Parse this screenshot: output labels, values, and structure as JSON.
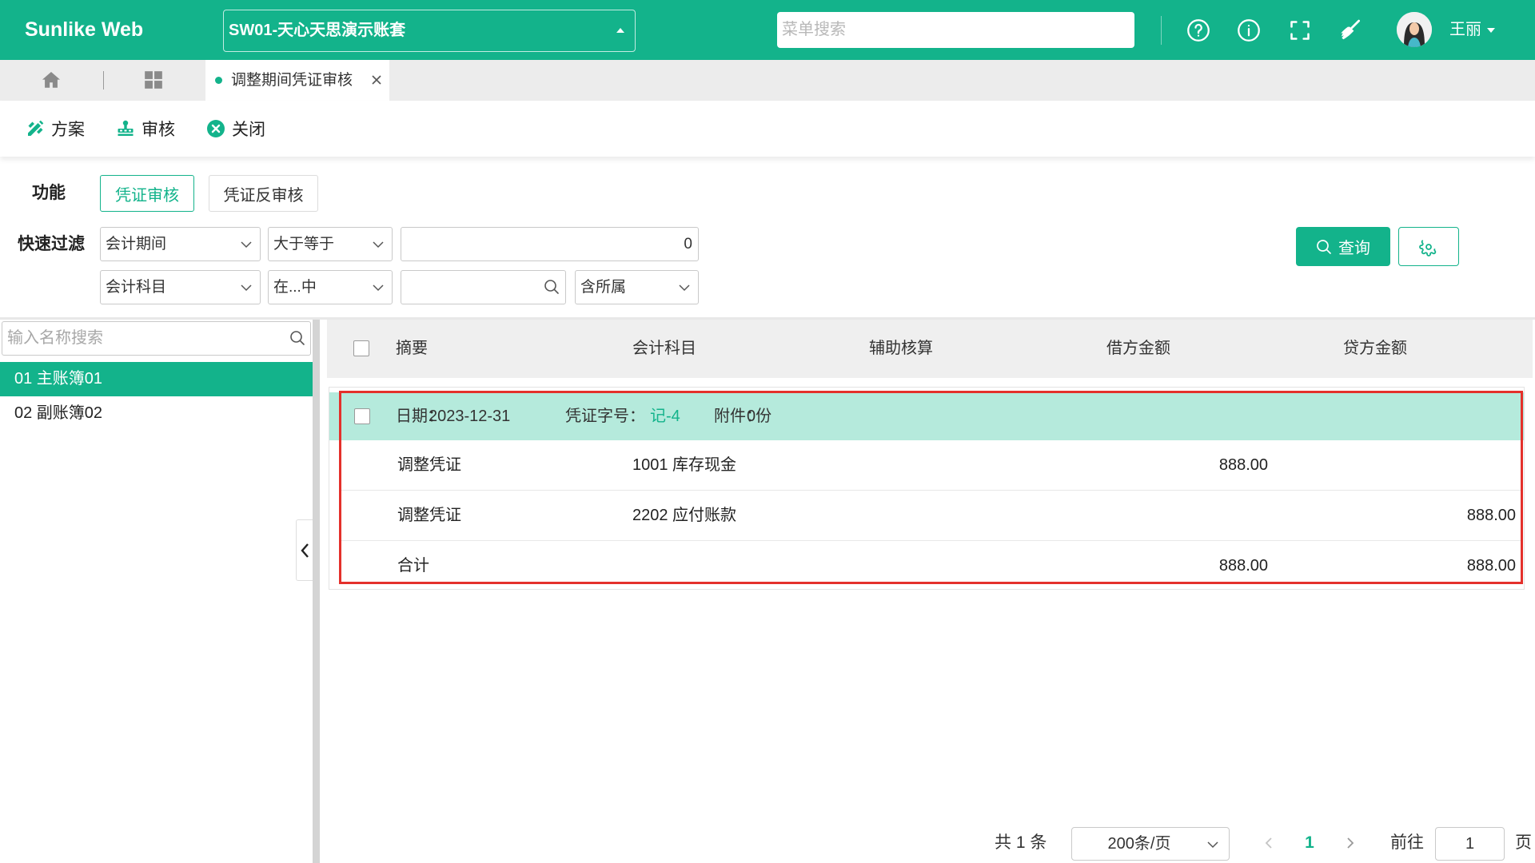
{
  "theme": {
    "primary": "#13b38b",
    "row_highlight": "#b5eadc",
    "highlight_border": "#e4302b"
  },
  "header": {
    "logo": "Sunlike Web",
    "account_set": "SW01-天心天思演示账套",
    "search_placeholder": "菜单搜索",
    "user_name": "王丽",
    "icons": [
      "help-icon",
      "info-icon",
      "fullscreen-icon",
      "clean-cache-icon",
      "avatar"
    ]
  },
  "tabbar": {
    "icons": [
      "home-icon",
      "grid-icon"
    ],
    "tabs": [
      {
        "label": "调整期间凭证审核",
        "active": true
      }
    ]
  },
  "toolbar": {
    "scheme_label": "方案",
    "audit_label": "审核",
    "close_label": "关闭"
  },
  "filter": {
    "function_label": "功能",
    "functions": [
      {
        "label": "凭证审核",
        "active": true
      },
      {
        "label": "凭证反审核"
      }
    ],
    "quick_filter_label": "快速过滤",
    "rows": [
      {
        "field": "会计期间",
        "operator": "大于等于",
        "value": "0"
      },
      {
        "field": "会计科目",
        "operator": "在...中",
        "scope": "含所属"
      }
    ],
    "query_label": "查询"
  },
  "sidebar": {
    "search_placeholder": "输入名称搜索",
    "items": [
      {
        "label": "01 主账簿01",
        "selected": true
      },
      {
        "label": "02 副账簿02"
      }
    ]
  },
  "table": {
    "columns": [
      "摘要",
      "会计科目",
      "辅助核算",
      "借方金额",
      "贷方金额"
    ],
    "voucher": {
      "date_label": "日期：",
      "date": "2023-12-31",
      "number_label": "凭证字号：",
      "number": "记-4",
      "attachment_label": "附件：",
      "attachment": "0份",
      "entries": [
        {
          "summary": "调整凭证",
          "account": "1001 库存现金",
          "debit": "888.00"
        },
        {
          "summary": "调整凭证",
          "account": "2202 应付账款",
          "credit": "888.00"
        }
      ],
      "total": {
        "label": "合计",
        "debit": "888.00",
        "credit": "888.00"
      }
    }
  },
  "pagination": {
    "total": "共 1 条",
    "page_size": "200条/页",
    "current_page": "1",
    "goto_label": "前往",
    "goto_value": "1",
    "page_suffix": "页"
  }
}
